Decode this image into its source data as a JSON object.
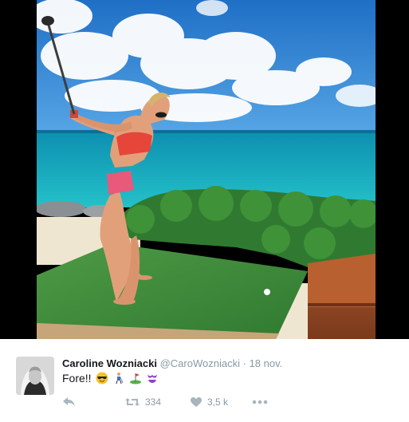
{
  "tweet": {
    "author_name": "Caroline Wozniacki",
    "handle": "@CaroWozniacki",
    "separator": "·",
    "date": "18 nov.",
    "text": "Fore!!",
    "emojis": [
      "smiling-face-with-sunglasses-emoji",
      "golfer-emoji",
      "flag-in-hole-emoji",
      "bikini-emoji"
    ],
    "retweet_count": "334",
    "like_count": "3,5 k"
  },
  "colors": {
    "name_text": "#14171a",
    "meta_text": "#8899a6",
    "sky": "#2f7fd1",
    "sea": "#1aa7c0",
    "turf": "#3f8a3a"
  },
  "photo": {
    "subject": "golf-swing-photo"
  }
}
